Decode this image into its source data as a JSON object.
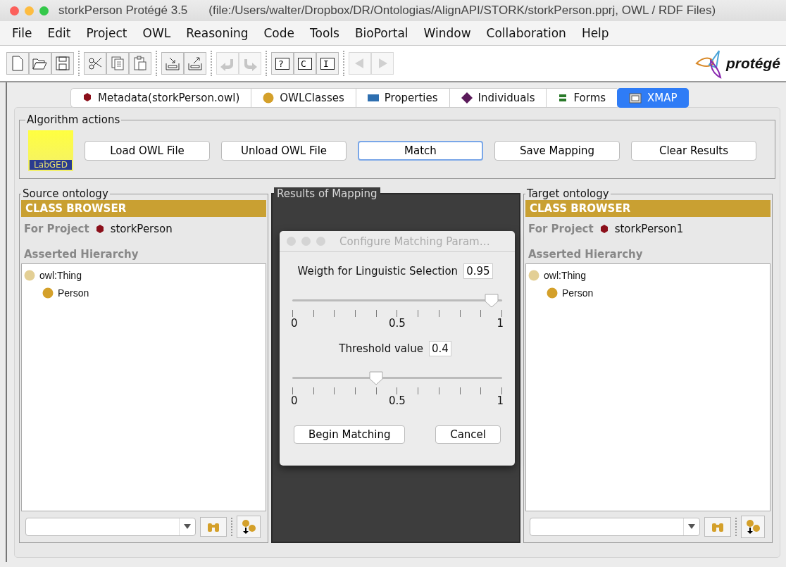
{
  "window": {
    "title": "storkPerson  Protégé 3.5",
    "file_info": "(file:/Users/walter/Dropbox/DR/Ontologias/AlignAPI/STORK/storkPerson.pprj, OWL / RDF Files)"
  },
  "menu": [
    "File",
    "Edit",
    "Project",
    "OWL",
    "Reasoning",
    "Code",
    "Tools",
    "BioPortal",
    "Window",
    "Collaboration",
    "Help"
  ],
  "toolbar": [
    [
      {
        "kind": "new",
        "disabled": false
      },
      {
        "kind": "open",
        "disabled": false
      },
      {
        "kind": "save",
        "disabled": false
      }
    ],
    [
      {
        "kind": "cut",
        "disabled": false
      },
      {
        "kind": "copy",
        "disabled": false
      },
      {
        "kind": "paste",
        "disabled": false
      }
    ],
    [
      {
        "kind": "import",
        "disabled": false
      },
      {
        "kind": "export",
        "disabled": false
      }
    ],
    [
      {
        "kind": "undo",
        "disabled": true
      },
      {
        "kind": "redo",
        "disabled": true
      }
    ],
    [
      {
        "kind": "letter",
        "label": "?",
        "disabled": false
      },
      {
        "kind": "letter",
        "label": "C",
        "disabled": false
      },
      {
        "kind": "letter",
        "label": "I",
        "disabled": false
      }
    ],
    [
      {
        "kind": "back",
        "disabled": true
      },
      {
        "kind": "forward",
        "disabled": true
      }
    ]
  ],
  "logo": {
    "text": "protégé"
  },
  "tabs": [
    {
      "label": "Metadata(storkPerson.owl)",
      "kind": "metadata",
      "selected": false
    },
    {
      "label": "OWLClasses",
      "kind": "classes",
      "selected": false
    },
    {
      "label": "Properties",
      "kind": "properties",
      "selected": false
    },
    {
      "label": "Individuals",
      "kind": "individuals",
      "selected": false
    },
    {
      "label": "Forms",
      "kind": "forms",
      "selected": false
    },
    {
      "label": "XMAP",
      "kind": "plugin",
      "selected": true
    }
  ],
  "algorithm_actions": {
    "title": "Algorithm actions",
    "logo_text": "LabGED",
    "buttons": [
      {
        "label": "Load OWL File",
        "focused": false
      },
      {
        "label": "Unload OWL File",
        "focused": false
      },
      {
        "label": "Match",
        "focused": true
      },
      {
        "label": "Save Mapping",
        "focused": false
      },
      {
        "label": "Clear Results",
        "focused": false
      }
    ]
  },
  "source": {
    "title": "Source ontology",
    "header": "CLASS BROWSER",
    "project_label": "For Project",
    "project": "storkPerson",
    "hierarchy_label": "Asserted Hierarchy",
    "tree": [
      {
        "label": "owl:Thing",
        "kind": "root",
        "children": [
          {
            "label": "Person",
            "kind": "class"
          }
        ]
      }
    ]
  },
  "results": {
    "title": "Results of Mapping"
  },
  "target": {
    "title": "Target ontology",
    "header": "CLASS BROWSER",
    "project_label": "For Project",
    "project": "storkPerson1",
    "hierarchy_label": "Asserted Hierarchy",
    "tree": [
      {
        "label": "owl:Thing",
        "kind": "root",
        "children": [
          {
            "label": "Person",
            "kind": "class"
          }
        ]
      }
    ]
  },
  "dialog": {
    "title": "Configure Matching Param…",
    "params": [
      {
        "label": "Weigth for Linguistic Selection",
        "value": "0.95",
        "level": 0.95,
        "tick_labels": [
          "0",
          "0.5",
          "1"
        ]
      },
      {
        "label": "Threshold value",
        "value": "0.4",
        "level": 0.4,
        "tick_labels": [
          "0",
          "0.5",
          "1"
        ]
      }
    ],
    "buttons": [
      "Begin Matching",
      "Cancel"
    ]
  }
}
